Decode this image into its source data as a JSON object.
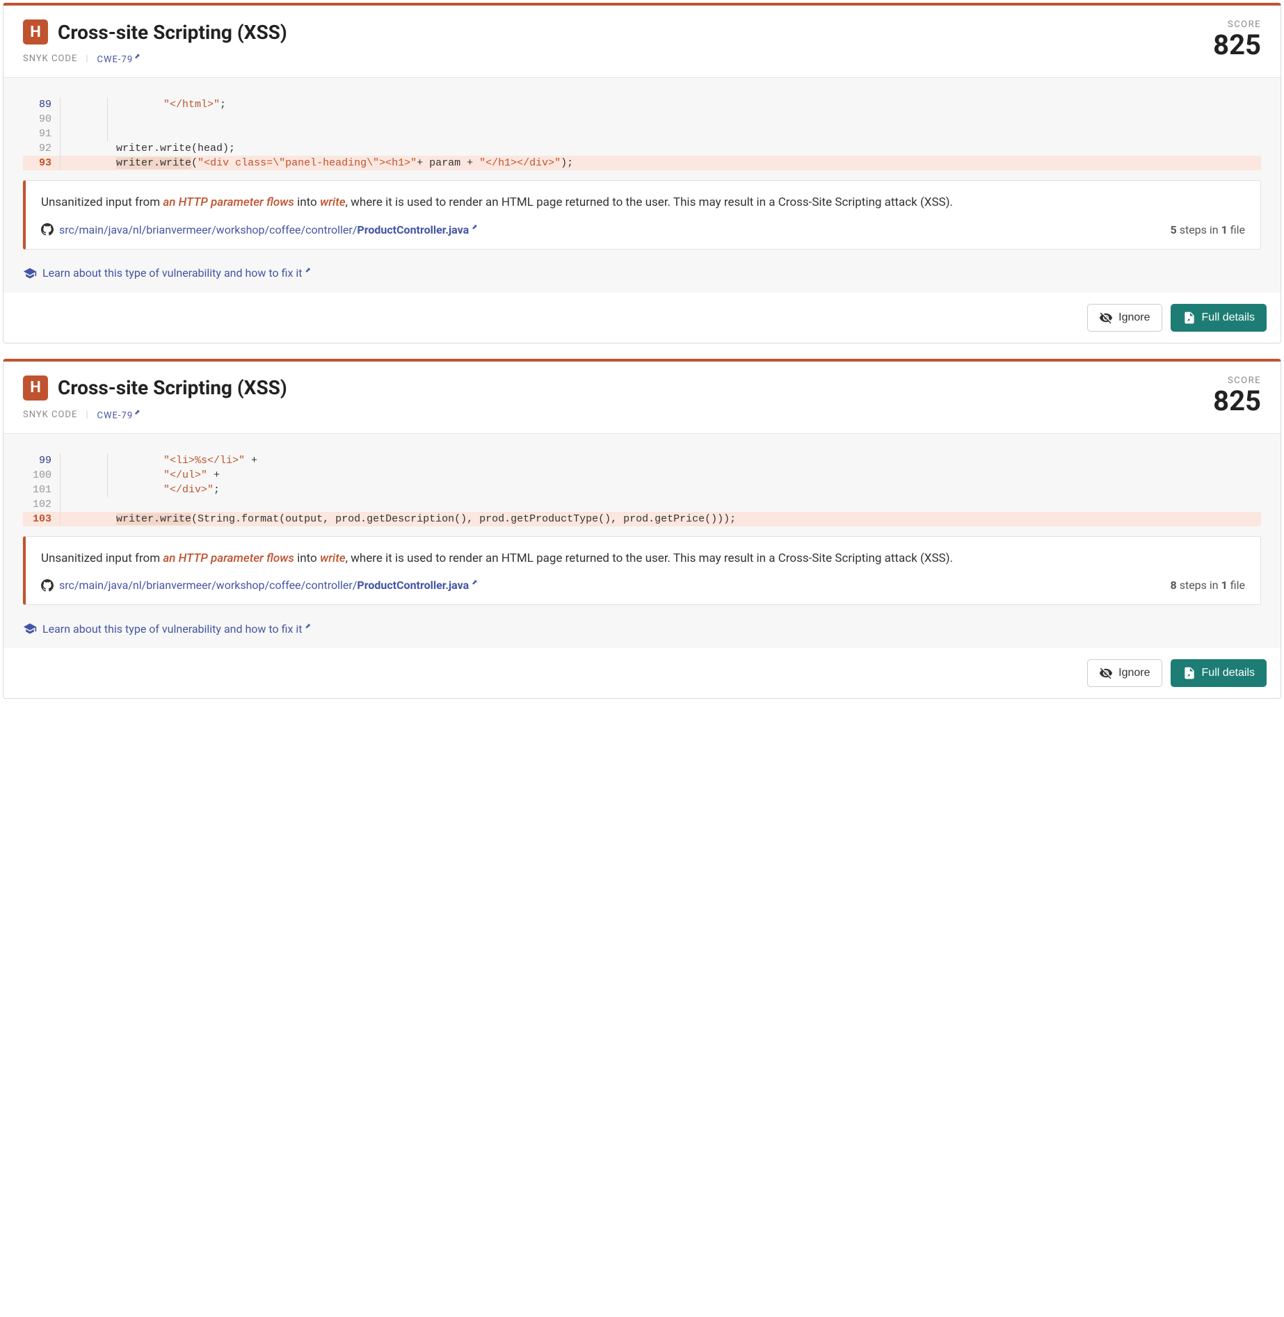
{
  "cards": [
    {
      "severity_letter": "H",
      "title": "Cross-site Scripting (XSS)",
      "source": "SNYK CODE",
      "cwe": "CWE-79",
      "score_label": "SCORE",
      "score_value": "825",
      "code_lines": [
        {
          "num": "89",
          "num_class": "dark",
          "indent_gutter": true,
          "hl": false,
          "segs": [
            {
              "t": "        ",
              "c": ""
            },
            {
              "t": "\"</html>\"",
              "c": "tok-str"
            },
            {
              "t": ";",
              "c": ""
            }
          ]
        },
        {
          "num": "90",
          "num_class": "",
          "indent_gutter": true,
          "hl": false,
          "segs": []
        },
        {
          "num": "91",
          "num_class": "",
          "indent_gutter": true,
          "hl": false,
          "segs": []
        },
        {
          "num": "92",
          "num_class": "",
          "indent_gutter": false,
          "hl": false,
          "segs": [
            {
              "t": "        writer.write(head);",
              "c": ""
            }
          ]
        },
        {
          "num": "93",
          "num_class": "hl",
          "indent_gutter": false,
          "hl": true,
          "segs": [
            {
              "t": "        ",
              "c": ""
            },
            {
              "t": "writer.write",
              "c": "tok-underline"
            },
            {
              "t": "(",
              "c": ""
            },
            {
              "t": "\"<div class=\\\"panel-heading\\\"><h1>\"",
              "c": "tok-str"
            },
            {
              "t": "+ param + ",
              "c": ""
            },
            {
              "t": "\"</h1></div>\"",
              "c": "tok-str"
            },
            {
              "t": ");",
              "c": ""
            }
          ]
        }
      ],
      "info": {
        "pre": "Unsanitized input from ",
        "em1": "an HTTP parameter flows",
        "mid1": " into ",
        "em2": "write",
        "post": ", where it is used to render an HTML page returned to the user. This may result in a Cross-Site Scripting attack (XSS)."
      },
      "path_prefix": "src/main/java/nl/brianvermeer/workshop/coffee/controller/",
      "path_file": "ProductController.java",
      "steps_count": "5",
      "steps_word": "steps in",
      "file_count": "1",
      "file_word": "file",
      "learn_text": "Learn about this type of vulnerability and how to fix it",
      "ignore_label": "Ignore",
      "details_label": "Full details"
    },
    {
      "severity_letter": "H",
      "title": "Cross-site Scripting (XSS)",
      "source": "SNYK CODE",
      "cwe": "CWE-79",
      "score_label": "SCORE",
      "score_value": "825",
      "code_lines": [
        {
          "num": "99",
          "num_class": "dark",
          "indent_gutter": true,
          "hl": false,
          "segs": [
            {
              "t": "        ",
              "c": ""
            },
            {
              "t": "\"<li>%s</li>\"",
              "c": "tok-str"
            },
            {
              "t": " +",
              "c": ""
            }
          ]
        },
        {
          "num": "100",
          "num_class": "",
          "indent_gutter": true,
          "hl": false,
          "segs": [
            {
              "t": "        ",
              "c": ""
            },
            {
              "t": "\"</ul>\"",
              "c": "tok-str"
            },
            {
              "t": " +",
              "c": ""
            }
          ]
        },
        {
          "num": "101",
          "num_class": "",
          "indent_gutter": true,
          "hl": false,
          "segs": [
            {
              "t": "        ",
              "c": ""
            },
            {
              "t": "\"</div>\"",
              "c": "tok-str"
            },
            {
              "t": ";",
              "c": ""
            }
          ]
        },
        {
          "num": "102",
          "num_class": "",
          "indent_gutter": false,
          "hl": false,
          "segs": []
        },
        {
          "num": "103",
          "num_class": "hl",
          "indent_gutter": false,
          "hl": true,
          "segs": [
            {
              "t": "        ",
              "c": ""
            },
            {
              "t": "writer.write",
              "c": "tok-underline"
            },
            {
              "t": "(String.format(output, prod.getDescription(), prod.getProductType(), prod.getPrice()));",
              "c": ""
            }
          ]
        }
      ],
      "info": {
        "pre": "Unsanitized input from ",
        "em1": "an HTTP parameter flows",
        "mid1": " into ",
        "em2": "write",
        "post": ", where it is used to render an HTML page returned to the user. This may result in a Cross-Site Scripting attack (XSS)."
      },
      "path_prefix": "src/main/java/nl/brianvermeer/workshop/coffee/controller/",
      "path_file": "ProductController.java",
      "steps_count": "8",
      "steps_word": "steps in",
      "file_count": "1",
      "file_word": "file",
      "learn_text": "Learn about this type of vulnerability and how to fix it",
      "ignore_label": "Ignore",
      "details_label": "Full details"
    }
  ]
}
